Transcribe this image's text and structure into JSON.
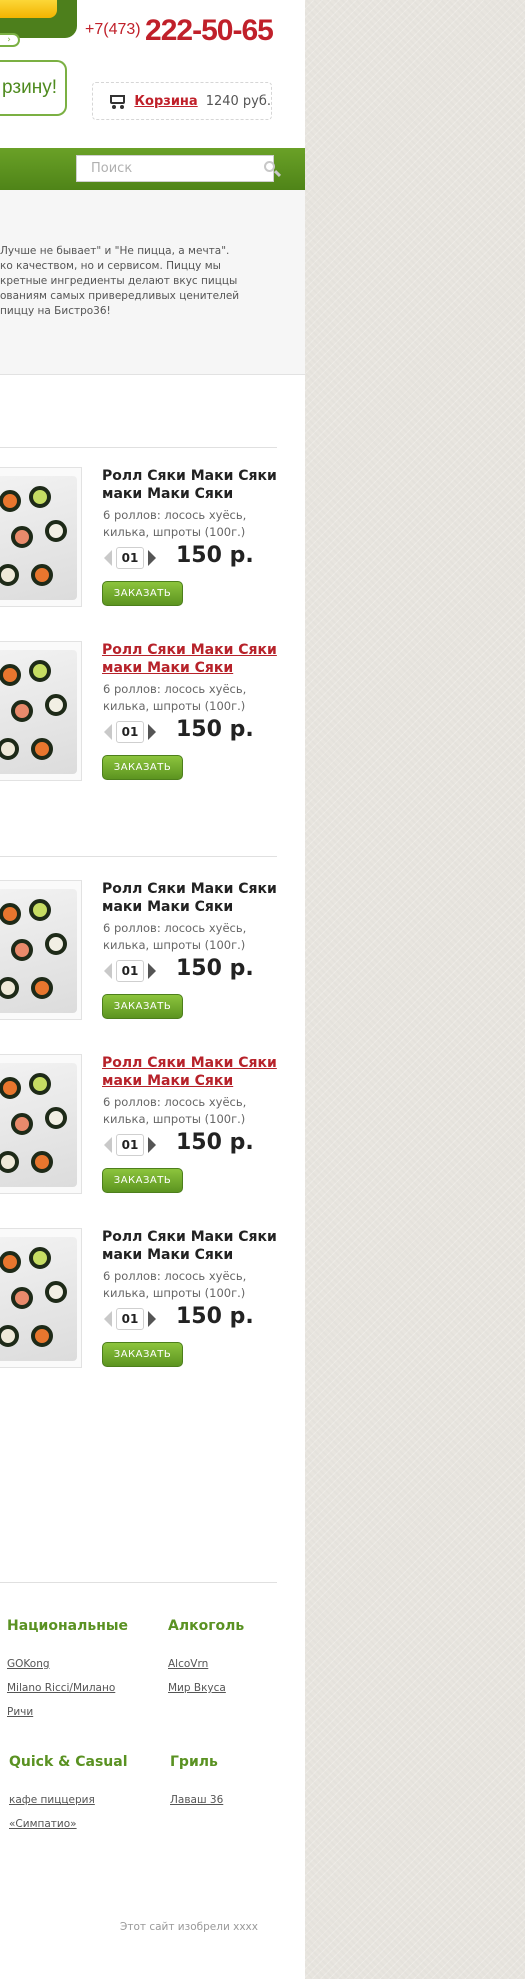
{
  "header": {
    "phone_code": "+7(473)",
    "phone_number": "222-50-65",
    "cart_cta_text": "рзину!",
    "cart": {
      "label": "Корзина",
      "sum": "1240 руб."
    }
  },
  "search": {
    "placeholder": "Поиск"
  },
  "intro": {
    "lines": [
      "Лучше не бывает\" и \"Не пицца, а мечта\".",
      "ко качеством, но и сервисом. Пиццу мы",
      "кретные ингредиенты делают вкус пиццы",
      "ованиям самых привередливых ценителей",
      "пиццу на Бистро36!"
    ]
  },
  "products": [
    {
      "title": "Ролл Сяки Маки Сяки маки Маки Сяки",
      "link": false,
      "desc": "6 роллов: лосось хуёсь, килька, шпроты (100г.)",
      "qty": "01",
      "price": "150 р.",
      "button": "ЗАКАЗАТЬ"
    },
    {
      "title": "Ролл Сяки Маки Сяки маки Маки Сяки",
      "link": true,
      "desc": "6 роллов: лосось хуёсь, килька, шпроты (100г.)",
      "qty": "01",
      "price": "150 р.",
      "button": "ЗАКАЗАТЬ"
    },
    {
      "title": "Ролл Сяки Маки Сяки маки Маки Сяки",
      "link": false,
      "desc": "6 роллов: лосось хуёсь, килька, шпроты (100г.)",
      "qty": "01",
      "price": "150 р.",
      "button": "ЗАКАЗАТЬ"
    },
    {
      "title": "Ролл Сяки Маки Сяки маки Маки Сяки",
      "link": true,
      "desc": "6 роллов: лосось хуёсь, килька, шпроты (100г.)",
      "qty": "01",
      "price": "150 р.",
      "button": "ЗАКАЗАТЬ"
    },
    {
      "title": "Ролл Сяки Маки Сяки маки Маки Сяки",
      "link": false,
      "desc": "6 роллов: лосось хуёсь, килька, шпроты (100г.)",
      "qty": "01",
      "price": "150 р.",
      "button": "ЗАКАЗАТЬ"
    }
  ],
  "footer": {
    "columns": [
      {
        "heading": "Национальные",
        "links": [
          "GOKong",
          "Milano Ricci/Милано",
          "Ричи"
        ]
      },
      {
        "heading": "Алкоголь",
        "links": [
          "AlcoVrn",
          "Мир Вкуса"
        ]
      },
      {
        "heading": "Quick & Casual",
        "links": [
          "кафе пиццерия",
          "«Симпатио»"
        ]
      },
      {
        "heading": "Гриль",
        "links": [
          "Лаваш 36"
        ]
      }
    ],
    "credit": "Этот сайт изобрели xxxx"
  },
  "colors": {
    "brand_green": "#5a9222",
    "accent_red": "#c0202a",
    "background": "#e8e5df"
  }
}
